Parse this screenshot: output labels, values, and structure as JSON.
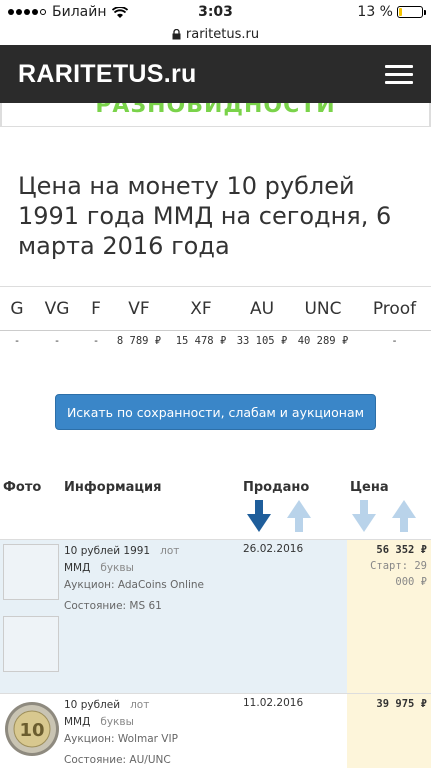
{
  "status": {
    "carrier": "Билайн",
    "time": "3:03",
    "battery": "13 %",
    "battery_level": 0.13,
    "url": "raritetus.ru"
  },
  "nav": {
    "brand": "RARITETUS.ru"
  },
  "prev_section_text": "РАЗНОВИДНОСТИ",
  "page_title": "Цена на монету 10 рублей 1991 года ММД на сегодня, 6 марта 2016 года",
  "grades": {
    "headers": [
      "G",
      "VG",
      "F",
      "VF",
      "XF",
      "AU",
      "UNC",
      "Proof"
    ],
    "values": [
      "-",
      "-",
      "-",
      "8 789 ₽",
      "15 478 ₽",
      "33 105 ₽",
      "40 289 ₽",
      "-"
    ]
  },
  "search_button": "Искать по сохранности, слабам и аукционам",
  "table": {
    "headers": {
      "photo": "Фото",
      "info": "Информация",
      "sold": "Продано",
      "price": "Цена"
    },
    "rows": [
      {
        "title": "10 рублей 1991",
        "lot": "лот",
        "mint": "ММД",
        "letters": "буквы",
        "auction": "Аукцион: AdaCoins Online",
        "condition": "Состояние: MS 61",
        "date": "26.02.2016",
        "price": "56 352 ₽",
        "start_line1": "Старт: 29",
        "start_line2": "000 ₽"
      },
      {
        "title": "10 рублей",
        "lot": "лот",
        "mint": "ММД",
        "letters": "буквы",
        "auction": "Аукцион: Wolmar VIP",
        "condition": "Состояние: AU/UNC",
        "date": "11.02.2016",
        "price": "39 975 ₽",
        "coin_text": "10"
      }
    ]
  },
  "colors": {
    "navbar": "#2b2b2b",
    "button": "#3a86c8",
    "row_highlight": "#e7f0f6",
    "price_bg": "#fdf5da",
    "arrow_active": "#1f5e9b",
    "arrow_inactive": "#b9d3ea"
  }
}
